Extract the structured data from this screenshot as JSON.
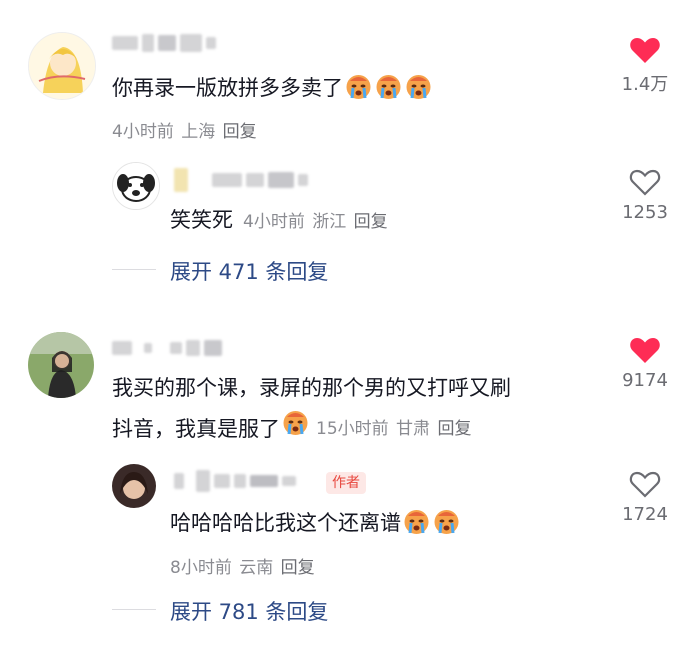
{
  "comments": [
    {
      "text": "你再录一版放拼多多卖了",
      "emoji_count": 3,
      "meta": {
        "time": "4小时前",
        "location": "上海",
        "reply": "回复"
      },
      "like": {
        "liked": true,
        "count": "1.4万"
      },
      "reply": {
        "text": "笑笑死",
        "meta": {
          "time": "4小时前",
          "location": "浙江",
          "reply": "回复"
        },
        "like": {
          "liked": false,
          "count": "1253"
        }
      },
      "expand_label": "展开 471 条回复"
    },
    {
      "text_line1": "我买的那个课，录屏的那个男的又打呼又刷",
      "text_line2": "抖音，我真是服了",
      "emoji_count": 1,
      "meta": {
        "time": "15小时前",
        "location": "甘肃",
        "reply": "回复"
      },
      "like": {
        "liked": true,
        "count": "9174"
      },
      "reply": {
        "author_tag": "作者",
        "text": "哈哈哈哈比我这个还离谱",
        "emoji_count": 2,
        "meta": {
          "time": "8小时前",
          "location": "云南",
          "reply": "回复"
        },
        "like": {
          "liked": false,
          "count": "1724"
        }
      },
      "expand_label": "展开 781 条回复"
    }
  ],
  "colors": {
    "liked": "#fe2c55",
    "link": "#2d4a86",
    "meta": "#8a8b91"
  }
}
